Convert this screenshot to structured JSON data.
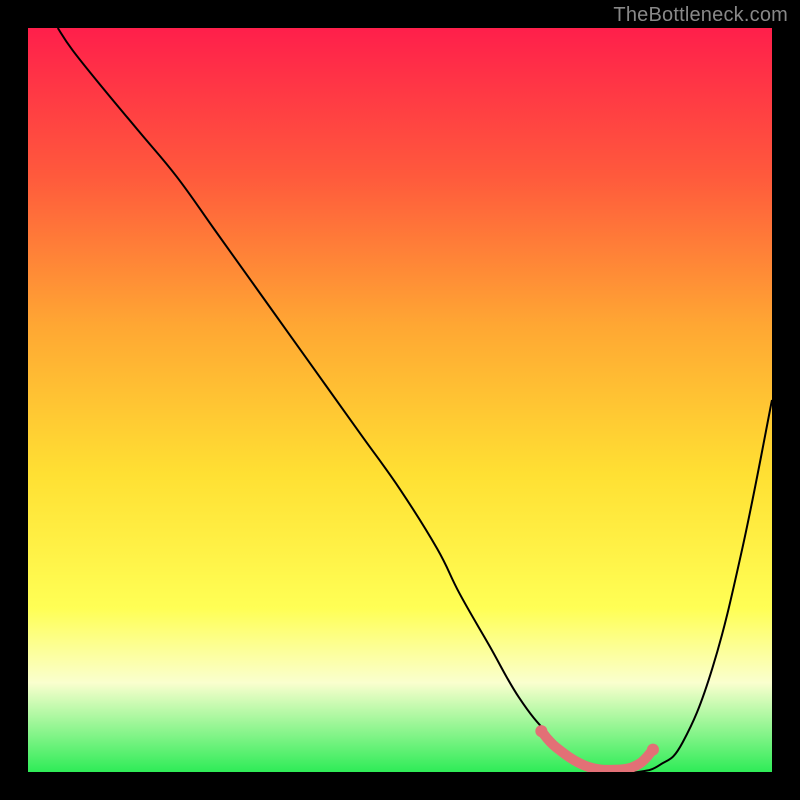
{
  "watermark": "TheBottleneck.com",
  "chart_data": {
    "type": "line",
    "title": "",
    "xlabel": "",
    "ylabel": "",
    "xlim": [
      0,
      100
    ],
    "ylim": [
      0,
      100
    ],
    "gradient_stops": [
      {
        "offset": 0,
        "color": "#ff1f4b"
      },
      {
        "offset": 20,
        "color": "#ff5a3c"
      },
      {
        "offset": 40,
        "color": "#ffa733"
      },
      {
        "offset": 60,
        "color": "#ffe033"
      },
      {
        "offset": 78,
        "color": "#ffff55"
      },
      {
        "offset": 88,
        "color": "#faffce"
      },
      {
        "offset": 100,
        "color": "#2eec57"
      }
    ],
    "series": [
      {
        "name": "bottleneck-curve",
        "x": [
          4,
          6,
          10,
          15,
          20,
          25,
          30,
          35,
          40,
          45,
          50,
          55,
          58,
          62,
          66,
          70,
          74,
          78,
          82,
          85,
          88,
          92,
          96,
          100
        ],
        "y": [
          100,
          97,
          92,
          86,
          80,
          73,
          66,
          59,
          52,
          45,
          38,
          30,
          24,
          17,
          10,
          5,
          1.5,
          0,
          0,
          1,
          4,
          14,
          30,
          50
        ]
      }
    ],
    "highlight_band": {
      "name": "optimal-range",
      "color": "#e27076",
      "x": [
        69,
        71,
        75,
        79,
        82,
        84
      ],
      "y": [
        5.5,
        3.3,
        0.8,
        0.3,
        1.0,
        3.0
      ],
      "end_dots": [
        {
          "x": 69,
          "y": 5.5
        },
        {
          "x": 84,
          "y": 3.0
        }
      ]
    }
  }
}
